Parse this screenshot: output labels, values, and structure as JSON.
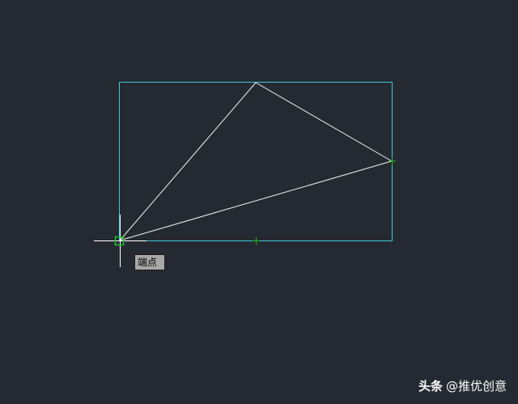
{
  "tooltip": {
    "label": "端点"
  },
  "watermark": {
    "brand": "头条",
    "handle": "@推优创意"
  },
  "colors": {
    "background": "#252a32",
    "rectangle": "#3ec8d4",
    "lines": "#f2f2f2",
    "snap_marker": "#1fbf2b",
    "crosshair": "#ffffff"
  }
}
